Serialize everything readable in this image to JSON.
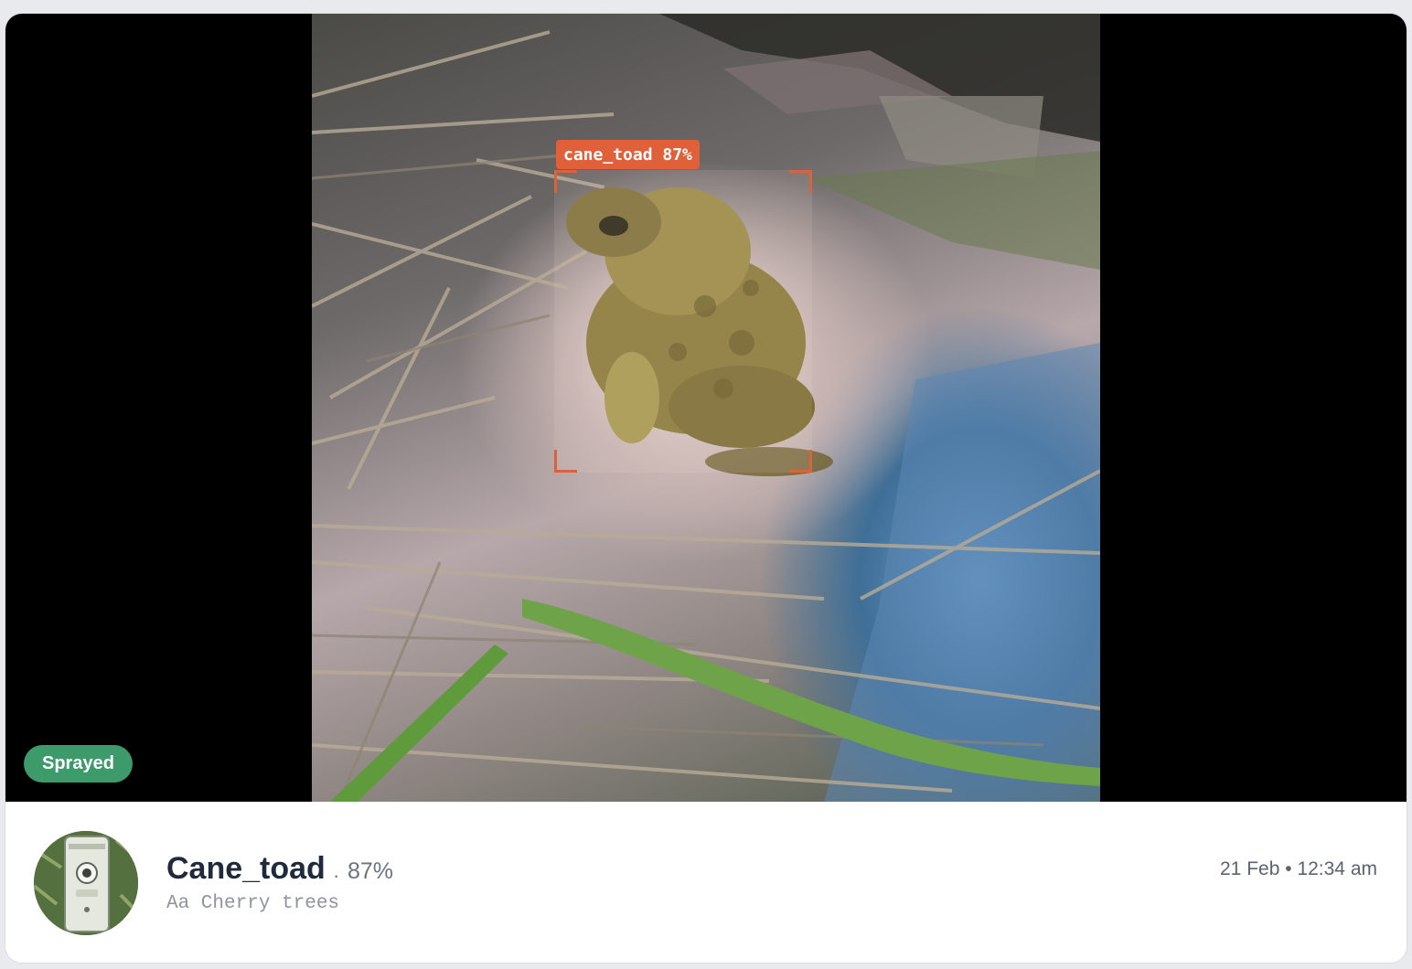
{
  "detection": {
    "label": "cane_toad 87%",
    "status_badge": "Sprayed",
    "box_color": "#e0603a"
  },
  "footer": {
    "species": "Cane_toad",
    "separator": "·",
    "confidence": "87%",
    "location": "Aa Cherry trees",
    "date": "21 Feb",
    "date_separator": "•",
    "time": "12:34 am"
  },
  "colors": {
    "badge": "#3d9a6b",
    "title": "#1f2a3d",
    "muted": "#6b7280"
  }
}
